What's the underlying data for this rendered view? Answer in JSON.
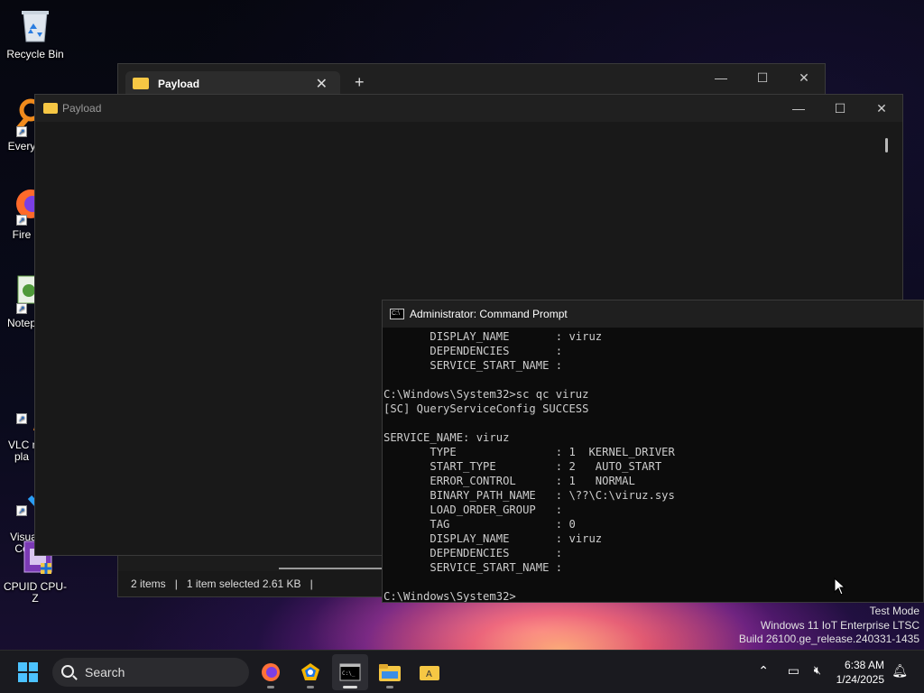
{
  "desktop": {
    "icons": [
      {
        "label": "Recycle Bin"
      },
      {
        "label": "Every"
      },
      {
        "label": "Fire"
      },
      {
        "label": "Notep"
      },
      {
        "label": "VLC m\npla"
      },
      {
        "label": "Visual\nCo"
      },
      {
        "label": "CPUID CPU-Z"
      }
    ]
  },
  "explorer_back": {
    "tab_title": "Payload",
    "close_glyph": "✕",
    "newtab_glyph": "+",
    "status": {
      "items": "2 items",
      "selected": "1 item selected  2.61 KB"
    }
  },
  "explorer_front": {
    "title": "Payload"
  },
  "cmd": {
    "title": "Administrator: Command Prompt",
    "lines": [
      "       DISPLAY_NAME       : viruz",
      "       DEPENDENCIES       :",
      "       SERVICE_START_NAME :",
      "",
      "C:\\Windows\\System32>sc qc viruz",
      "[SC] QueryServiceConfig SUCCESS",
      "",
      "SERVICE_NAME: viruz",
      "       TYPE               : 1  KERNEL_DRIVER",
      "       START_TYPE         : 2   AUTO_START",
      "       ERROR_CONTROL      : 1   NORMAL",
      "       BINARY_PATH_NAME   : \\??\\C:\\viruz.sys",
      "       LOAD_ORDER_GROUP   :",
      "       TAG                : 0",
      "       DISPLAY_NAME       : viruz",
      "       DEPENDENCIES       :",
      "       SERVICE_START_NAME :",
      "",
      "C:\\Windows\\System32>"
    ]
  },
  "watermark": {
    "line1": "Test Mode",
    "line2": "Windows 11 IoT Enterprise LTSC",
    "line3": "Build 26100.ge_release.240331-1435"
  },
  "taskbar": {
    "search_placeholder": "Search",
    "apps": [
      "firefox-icon",
      "chromium-icon",
      "terminal-icon",
      "file-explorer-icon",
      "payload-folder-icon"
    ],
    "clock_time": "6:38 AM",
    "clock_date": "1/24/2025"
  },
  "colors": {
    "accent": "#4cc2ff",
    "folder": "#f6c744"
  }
}
